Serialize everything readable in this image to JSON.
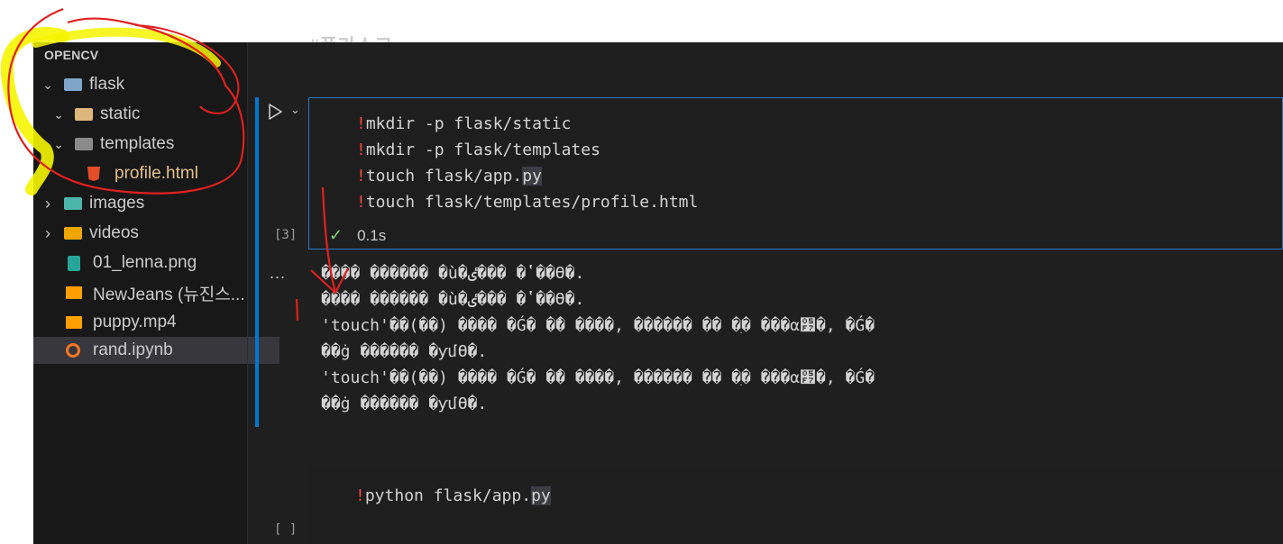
{
  "editor": {
    "heading_fragment": "#플라스크"
  },
  "explorer": {
    "section_title": "OPENCV",
    "items": [
      {
        "label": "flask",
        "kind": "folder-open",
        "chevron": "⌄"
      },
      {
        "label": "static",
        "kind": "folder-yellow",
        "chevron": "⌄"
      },
      {
        "label": "templates",
        "kind": "folder-gray",
        "chevron": "⌄"
      },
      {
        "label": "profile.html",
        "kind": "html-file"
      },
      {
        "label": "images",
        "kind": "folder-teal",
        "chevron": "›"
      },
      {
        "label": "videos",
        "kind": "folder-yellow",
        "chevron": "›"
      },
      {
        "label": "01_lenna.png",
        "kind": "image-file"
      },
      {
        "label": "NewJeans (뉴진스...",
        "kind": "video-file"
      },
      {
        "label": "puppy.mp4",
        "kind": "video-file"
      },
      {
        "label": "rand.ipynb",
        "kind": "notebook-file",
        "selected": true
      }
    ]
  },
  "cell1": {
    "exec_count": "[3]",
    "lines": [
      {
        "bang": "!",
        "rest": "mkdir -p flask/static"
      },
      {
        "bang": "!",
        "rest": "mkdir -p flask/templates"
      },
      {
        "bang": "!",
        "rest": "touch flask/app.",
        "hl": "py"
      },
      {
        "bang": "!",
        "rest": "touch flask/templates/profile.html"
      }
    ],
    "status_time": "0.1s"
  },
  "output": {
    "more_icon": "...",
    "lines": [
      "���� ������ �ù�ٸ��� �ʽ��ϴ�.",
      "���� ������ �ù�ٸ��� �ʽ��ϴ�.",
      "'touch'��(��) ���� �Ǵ� �ܺ� ����, ������ �� �ִ� ���α׷�, �Ǵ�",
      "��ġ ������ �ƴմϴ�.",
      "'touch'��(��) ���� �Ǵ� �ܺ� ����, ������ �� �ִ� ���α׷�, �Ǵ�",
      "��ġ ������ �ƴմϴ�."
    ]
  },
  "cell2": {
    "exec_count": "[ ]",
    "bang": "!",
    "code": "python flask/app.",
    "hl": "py"
  },
  "colors": {
    "accent": "#0078d4",
    "bang": "#f44747",
    "check": "#89d185",
    "annotation_red": "#e02020",
    "annotation_yellow": "#f5f500"
  }
}
